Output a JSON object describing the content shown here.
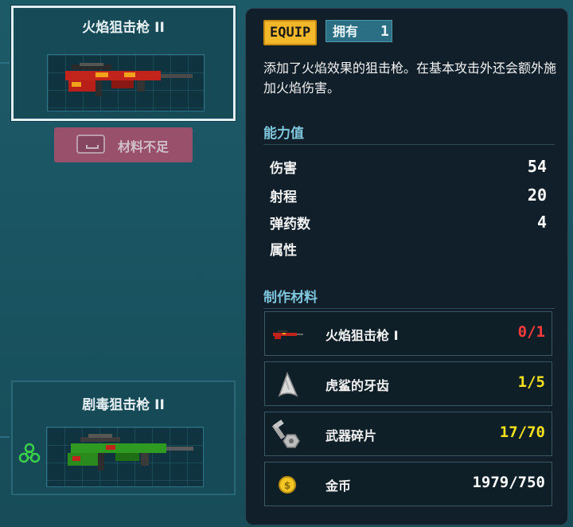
{
  "left_cards": [
    {
      "title": "火焰狙击枪 II",
      "selected": true
    },
    {
      "title": "剧毒狙击枪 II",
      "selected": false
    }
  ],
  "insufficient_label": "材料不足",
  "detail": {
    "equip_badge": "EQUIP",
    "owned_label": "拥有",
    "owned_count": "1",
    "description": "添加了火焰效果的狙击枪。在基本攻击外还会额外施加火焰伤害。",
    "stats_header": "能力值",
    "stats": [
      {
        "name": "伤害",
        "value": "54"
      },
      {
        "name": "射程",
        "value": "20"
      },
      {
        "name": "弹药数",
        "value": "4"
      },
      {
        "name": "属性",
        "value": ""
      }
    ],
    "materials_header": "制作材料",
    "materials": [
      {
        "name": "火焰狙击枪 I",
        "count": "0/1",
        "color": "#ff3b3b",
        "icon": "fire-sniper-icon"
      },
      {
        "name": "虎鲨的牙齿",
        "count": "1/5",
        "color": "#f5e21c",
        "icon": "shark-tooth-icon"
      },
      {
        "name": "武器碎片",
        "count": "17/70",
        "color": "#f5e21c",
        "icon": "weapon-fragment-icon"
      },
      {
        "name": "金币",
        "count": "1979/750",
        "color": "#ffffff",
        "icon": "coin-icon"
      }
    ]
  },
  "colors": {
    "accent": "#f2b82a",
    "section": "#7fc6dd",
    "insufficient": "#b04f6c"
  }
}
